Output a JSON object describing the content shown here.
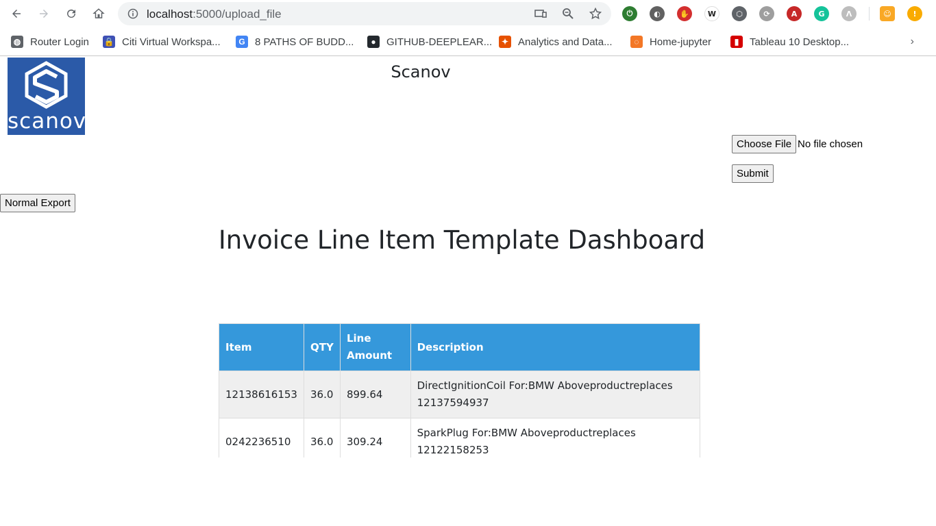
{
  "browser": {
    "url_host": "localhost",
    "url_path": ":5000/upload_file",
    "extensions": [
      {
        "name": "green-power-extension-icon",
        "glyph": "⏻",
        "color": "#2e7d32"
      },
      {
        "name": "grey-circle-extension-icon",
        "glyph": "◐",
        "color": "#616161"
      },
      {
        "name": "stop-hand-extension-icon",
        "glyph": "✋",
        "color": "#d32f2f"
      },
      {
        "name": "wikipedia-extension-icon",
        "glyph": "W",
        "color": "#ffffff"
      },
      {
        "name": "pocket-extension-icon",
        "glyph": "⬡",
        "color": "#5f6368"
      },
      {
        "name": "sync-extension-icon",
        "glyph": "⟳",
        "color": "#9e9e9e"
      },
      {
        "name": "pdf-extension-icon",
        "glyph": "A",
        "color": "#c62828"
      },
      {
        "name": "grammarly-extension-icon",
        "glyph": "G",
        "color": "#15c39a"
      },
      {
        "name": "grey-a-extension-icon",
        "glyph": "Λ",
        "color": "#bdbdbd"
      }
    ],
    "bookmarks": [
      {
        "label": "Router Login",
        "icon": "globe-icon",
        "color": "#5f6368",
        "glyph": "◍"
      },
      {
        "label": "Citi Virtual Workspa...",
        "icon": "lock-bag-icon",
        "color": "#3f51b5",
        "glyph": "🔒"
      },
      {
        "label": "8 PATHS OF BUDD...",
        "icon": "google-icon",
        "color": "#4285f4",
        "glyph": "G"
      },
      {
        "label": "GITHUB-DEEPLEAR...",
        "icon": "github-icon",
        "color": "#24292e",
        "glyph": "●"
      },
      {
        "label": "Analytics and Data...",
        "icon": "osu-icon",
        "color": "#e65100",
        "glyph": "✦"
      },
      {
        "label": "Home-jupyter",
        "icon": "jupyter-icon",
        "color": "#f37726",
        "glyph": "◌"
      },
      {
        "label": "Tableau 10 Desktop...",
        "icon": "pdf-icon",
        "color": "#d50000",
        "glyph": "▮"
      }
    ],
    "bookmarks_more": "›"
  },
  "page": {
    "logo_text": "scanov",
    "site_title": "Scanov",
    "choose_file_label": "Choose File",
    "file_status": "No file chosen",
    "submit_label": "Submit",
    "normal_export_label": "Normal Export",
    "dashboard_title": "Invoice Line Item Template Dashboard"
  },
  "table": {
    "headers": [
      "Item",
      "QTY",
      "Line Amount",
      "Description"
    ],
    "header_line_amount": [
      "Line",
      "Amount"
    ],
    "rows": [
      {
        "item": "12138616153",
        "qty": "36.0",
        "line_amount": "899.64",
        "description_l1": "DirectIgnitionCoil For:BMW Aboveproductreplaces",
        "description_l2": "12137594937"
      },
      {
        "item": "0242236510",
        "qty": "36.0",
        "line_amount": "309.24",
        "description_l1": "SparkPlug For:BMW Aboveproductreplaces",
        "description_l2": "12122158253"
      }
    ]
  },
  "colors": {
    "table_header": "#3598db",
    "logo_bg": "#2b5aa8"
  }
}
